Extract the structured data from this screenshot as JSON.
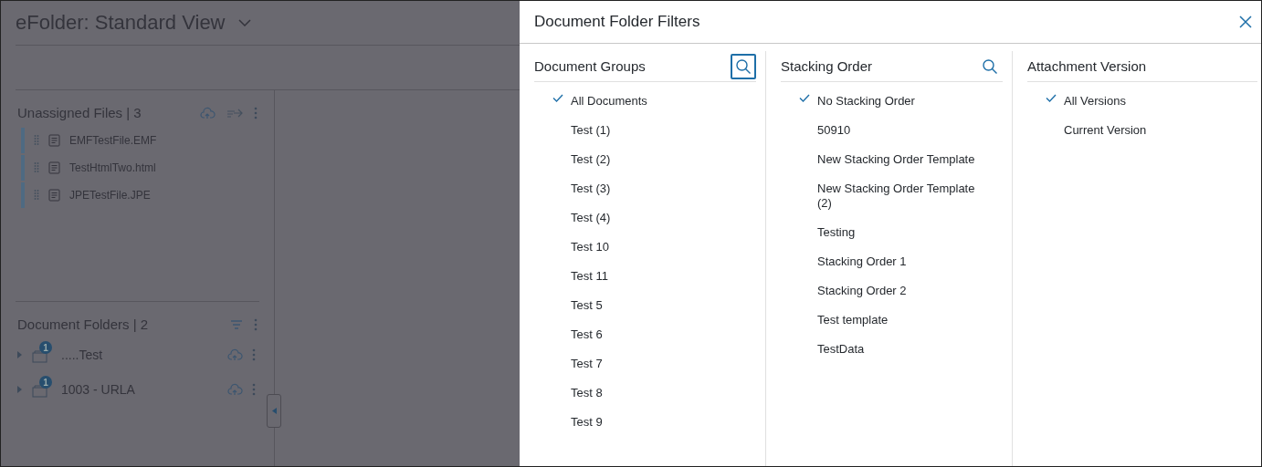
{
  "background": {
    "title": "eFolder: Standard View",
    "unassigned": {
      "heading": "Unassigned Files | 3",
      "files": [
        {
          "name": "EMFTestFile.EMF"
        },
        {
          "name": "TestHtmlTwo.html"
        },
        {
          "name": "JPETestFile.JPE"
        }
      ]
    },
    "folders": {
      "heading": "Document Folders | 2",
      "items": [
        {
          "name": ".....Test",
          "badge": "1",
          "expanded": false
        },
        {
          "name": "1003 - URLA",
          "badge": "1",
          "expanded": false
        }
      ]
    }
  },
  "panel": {
    "title": "Document Folder Filters",
    "columns": [
      {
        "heading": "Document Groups",
        "search_button": {
          "focused": true
        },
        "items": [
          {
            "label": "All Documents",
            "selected": true
          },
          {
            "label": "Test (1)",
            "selected": false
          },
          {
            "label": "Test (2)",
            "selected": false
          },
          {
            "label": "Test (3)",
            "selected": false
          },
          {
            "label": "Test (4)",
            "selected": false
          },
          {
            "label": "Test 10",
            "selected": false
          },
          {
            "label": "Test 11",
            "selected": false
          },
          {
            "label": "Test 5",
            "selected": false
          },
          {
            "label": "Test 6",
            "selected": false
          },
          {
            "label": "Test 7",
            "selected": false
          },
          {
            "label": "Test 8",
            "selected": false
          },
          {
            "label": "Test 9",
            "selected": false
          }
        ]
      },
      {
        "heading": "Stacking Order",
        "search_button": {
          "focused": false
        },
        "items": [
          {
            "label": "No Stacking Order",
            "selected": true
          },
          {
            "label": "50910",
            "selected": false
          },
          {
            "label": "New Stacking Order Template",
            "selected": false
          },
          {
            "label": "New Stacking Order Template (2)",
            "selected": false
          },
          {
            "label": "Testing",
            "selected": false
          },
          {
            "label": "Stacking Order 1",
            "selected": false
          },
          {
            "label": "Stacking Order 2",
            "selected": false
          },
          {
            "label": "Test template",
            "selected": false
          },
          {
            "label": "TestData",
            "selected": false
          }
        ]
      },
      {
        "heading": "Attachment Version",
        "items": [
          {
            "label": "All Versions",
            "selected": true
          },
          {
            "label": "Current Version",
            "selected": false
          }
        ]
      }
    ]
  }
}
